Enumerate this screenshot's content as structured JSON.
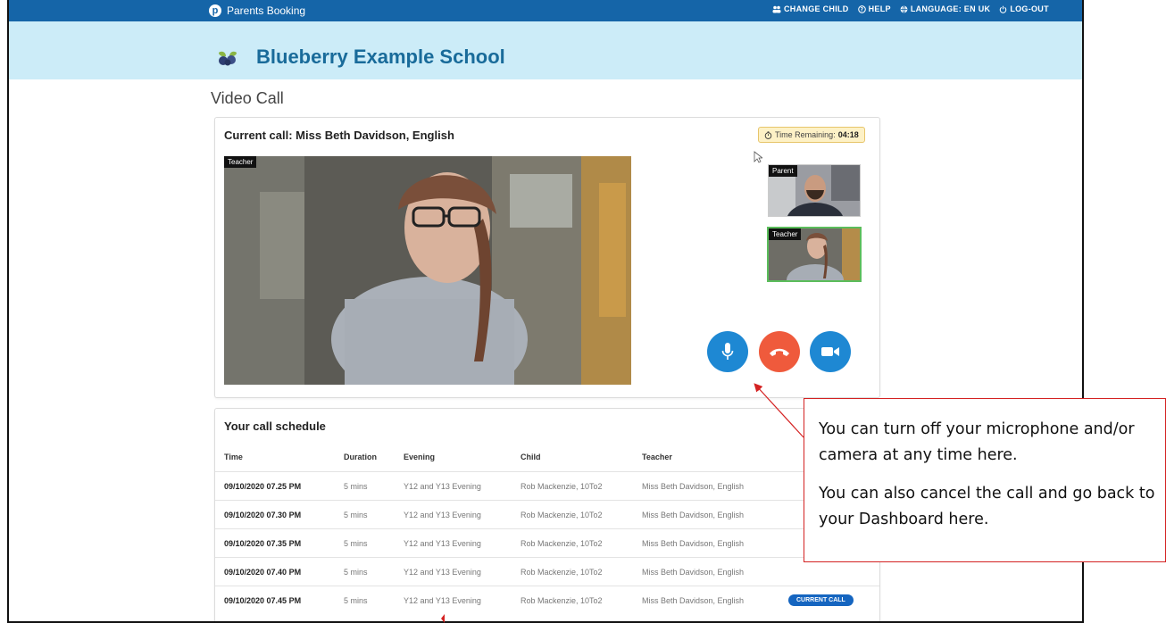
{
  "app": {
    "brand": "Parents Booking",
    "nav": [
      {
        "label": "CHANGE CHILD",
        "icon": "people-icon"
      },
      {
        "label": "HELP",
        "icon": "help-circle-icon"
      },
      {
        "label": "LANGUAGE: EN UK",
        "icon": "globe-icon"
      },
      {
        "label": "LOG-OUT",
        "icon": "power-icon"
      }
    ],
    "school_name": "Blueberry Example School"
  },
  "page": {
    "title": "Video Call"
  },
  "call": {
    "title": "Current call: Miss Beth Davidson, English",
    "timer_label": "Time Remaining:",
    "timer_value": "04:18",
    "main_video_label": "Teacher",
    "thumb_parent_label": "Parent",
    "thumb_teacher_label": "Teacher",
    "controls": [
      {
        "name": "microphone",
        "icon": "microphone-icon",
        "color": "#1e88d3"
      },
      {
        "name": "end-call",
        "icon": "hang-up-icon",
        "color": "#ef5a3c"
      },
      {
        "name": "camera",
        "icon": "video-camera-icon",
        "color": "#1e88d3"
      }
    ]
  },
  "schedule": {
    "title": "Your call schedule",
    "columns": [
      "Time",
      "Duration",
      "Evening",
      "Child",
      "Teacher"
    ],
    "rows": [
      {
        "time": "09/10/2020 07.25 PM",
        "duration": "5 mins",
        "evening": "Y12 and Y13 Evening",
        "child": "Rob Mackenzie, 10To2",
        "teacher": "Miss Beth Davidson, English",
        "status": ""
      },
      {
        "time": "09/10/2020 07.30 PM",
        "duration": "5 mins",
        "evening": "Y12 and Y13 Evening",
        "child": "Rob Mackenzie, 10To2",
        "teacher": "Miss Beth Davidson, English",
        "status": ""
      },
      {
        "time": "09/10/2020 07.35 PM",
        "duration": "5 mins",
        "evening": "Y12 and Y13 Evening",
        "child": "Rob Mackenzie, 10To2",
        "teacher": "Miss Beth Davidson, English",
        "status": ""
      },
      {
        "time": "09/10/2020 07.40 PM",
        "duration": "5 mins",
        "evening": "Y12 and Y13 Evening",
        "child": "Rob Mackenzie, 10To2",
        "teacher": "Miss Beth Davidson, English",
        "status": ""
      },
      {
        "time": "09/10/2020 07.45 PM",
        "duration": "5 mins",
        "evening": "Y12 and Y13 Evening",
        "child": "Rob Mackenzie, 10To2",
        "teacher": "Miss Beth Davidson, English",
        "status": "CURRENT CALL"
      }
    ]
  },
  "annotation": {
    "line1": "You can turn off your microphone and/or camera at any time here.",
    "line2": "You can also cancel the call and go back to your Dashboard here."
  },
  "colors": {
    "topbar": "#1565a8",
    "banner": "#ccecf8",
    "school_name": "#196b9a",
    "annotation_border": "#d42222",
    "current_badge": "#1565c0"
  }
}
